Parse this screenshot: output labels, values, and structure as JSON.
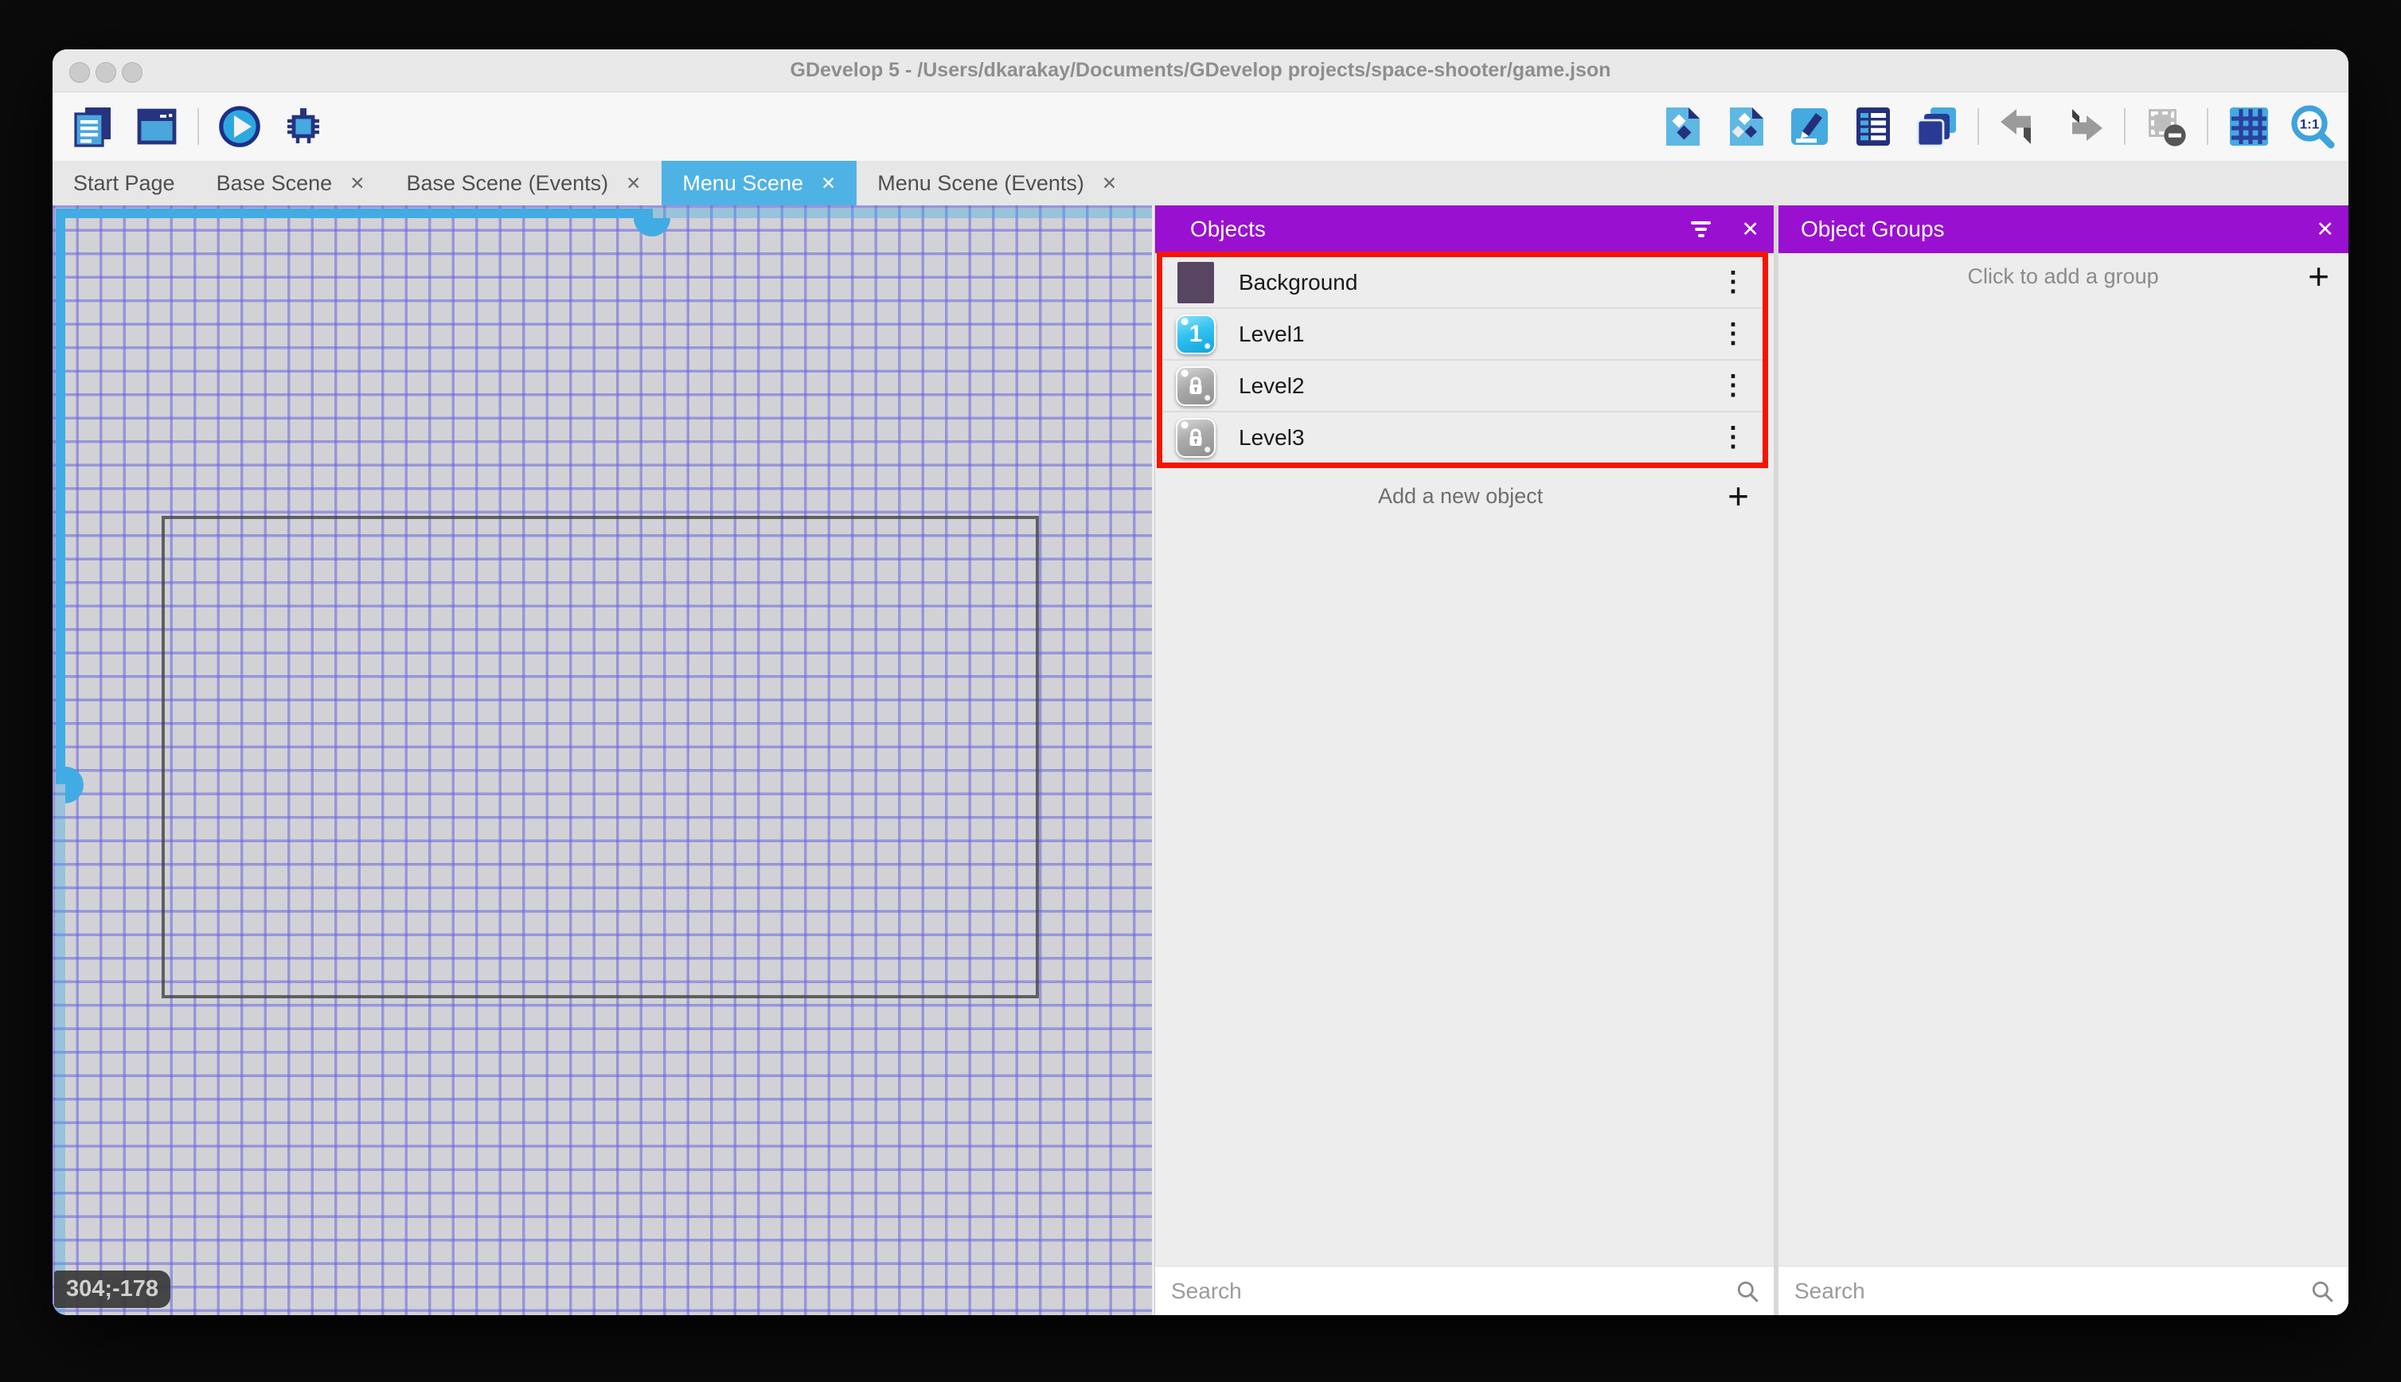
{
  "window": {
    "title": "GDevelop 5 - /Users/dkarakay/Documents/GDevelop projects/space-shooter/game.json"
  },
  "icons": {
    "close": "✕",
    "plus": "+",
    "kebab": "⋮"
  },
  "tabs": [
    {
      "label": "Start Page",
      "closable": false,
      "active": false
    },
    {
      "label": "Base Scene",
      "closable": true,
      "active": false
    },
    {
      "label": "Base Scene (Events)",
      "closable": true,
      "active": false
    },
    {
      "label": "Menu Scene",
      "closable": true,
      "active": true
    },
    {
      "label": "Menu Scene (Events)",
      "closable": true,
      "active": false
    }
  ],
  "toolbar": {
    "left_icons": [
      "project-manager",
      "scene-properties-window",
      "play-preview",
      "debug"
    ],
    "right_icons": [
      "open-objects-list",
      "open-object-groups",
      "open-properties",
      "open-instances-list",
      "open-layers",
      "undo",
      "redo",
      "clear-instances",
      "toggle-grid",
      "zoom-one-to-one"
    ]
  },
  "canvas": {
    "coordinate_readout": "304;-178"
  },
  "objects_panel": {
    "title": "Objects",
    "items": [
      {
        "name": "Background",
        "icon": "background-thumbnail"
      },
      {
        "name": "Level1",
        "icon": "level1-thumbnail",
        "badge": "1"
      },
      {
        "name": "Level2",
        "icon": "locked-thumbnail"
      },
      {
        "name": "Level3",
        "icon": "locked-thumbnail"
      }
    ],
    "add_label": "Add a new object",
    "search_placeholder": "Search"
  },
  "groups_panel": {
    "title": "Object Groups",
    "add_label": "Click to add a group",
    "search_placeholder": "Search"
  },
  "colors": {
    "panel_header": "#9a10d1",
    "active_tab": "#4fb2e4",
    "selection_blue": "#41ace3",
    "highlight_red": "#f51400"
  }
}
